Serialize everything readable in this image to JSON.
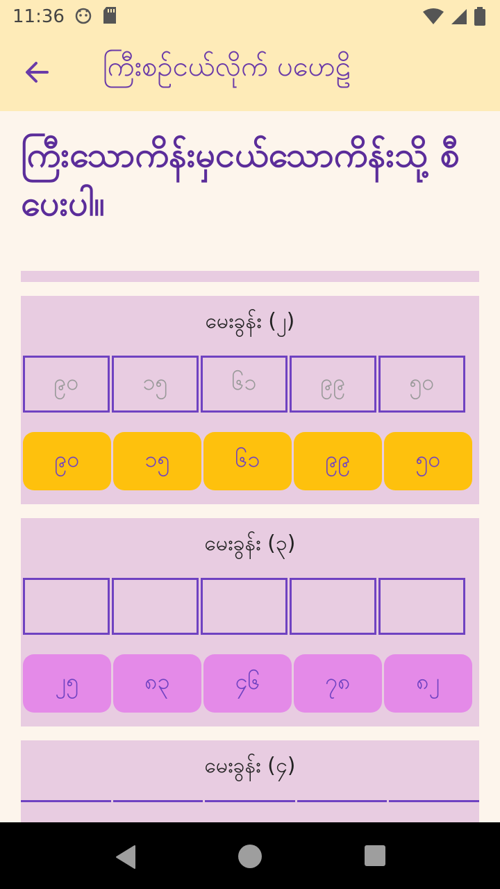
{
  "status": {
    "time": "11:36"
  },
  "app_bar": {
    "title": "ကြီးစဉ်ငယ်လိုက် ပဟေဠိ"
  },
  "instruction": "ကြီးသောကိန်းမှငယ်သောကိန်းသို့ စီပေးပါ။",
  "questions": [
    {
      "title": "မေးခွန်း (၂)",
      "slots": [
        "၉၀",
        "၁၅",
        "၆၁",
        "၉၉",
        "၅၀"
      ],
      "options": [
        "၉၀",
        "၁၅",
        "၆၁",
        "၉၉",
        "၅၀"
      ]
    },
    {
      "title": "မေးခွန်း (၃)",
      "slots": [
        "",
        "",
        "",
        "",
        ""
      ],
      "options": [
        "၂၅",
        "၈၃",
        "၄၆",
        "၇၈",
        "၈၂"
      ]
    },
    {
      "title": "မေးခွန်း (၄)"
    }
  ],
  "colors": {
    "accent": "#6f42c1",
    "selected": "#fec10d",
    "available": "#e48ae8",
    "card": "#e8cce1",
    "app_bar": "#feebb8"
  }
}
